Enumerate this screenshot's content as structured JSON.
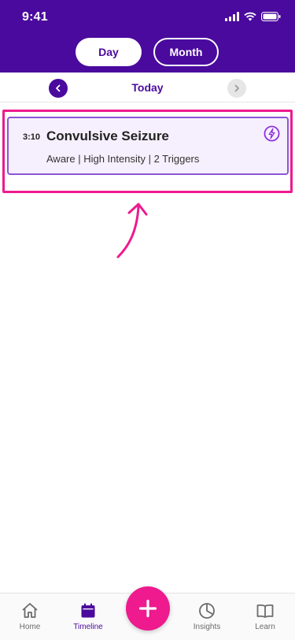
{
  "status_bar": {
    "time": "9:41"
  },
  "view_toggle": {
    "day_label": "Day",
    "month_label": "Month",
    "selected": "Day"
  },
  "date_nav": {
    "label": "Today"
  },
  "event": {
    "time": "3:10",
    "title": "Convulsive Seizure",
    "details": "Aware  |  High Intensity  |  2 Triggers",
    "icon": "lightning-icon"
  },
  "tabbar": {
    "items": [
      {
        "label": "Home",
        "icon": "home-icon"
      },
      {
        "label": "Timeline",
        "icon": "calendar-icon",
        "active": true
      },
      {
        "label": "Insights",
        "icon": "pie-chart-icon"
      },
      {
        "label": "Learn",
        "icon": "book-icon"
      }
    ],
    "fab_icon": "plus-icon"
  },
  "colors": {
    "brand_purple": "#4a0a9e",
    "accent_pink": "#ee1a8e",
    "card_bg": "#f6effd",
    "card_border": "#8c55d6"
  }
}
